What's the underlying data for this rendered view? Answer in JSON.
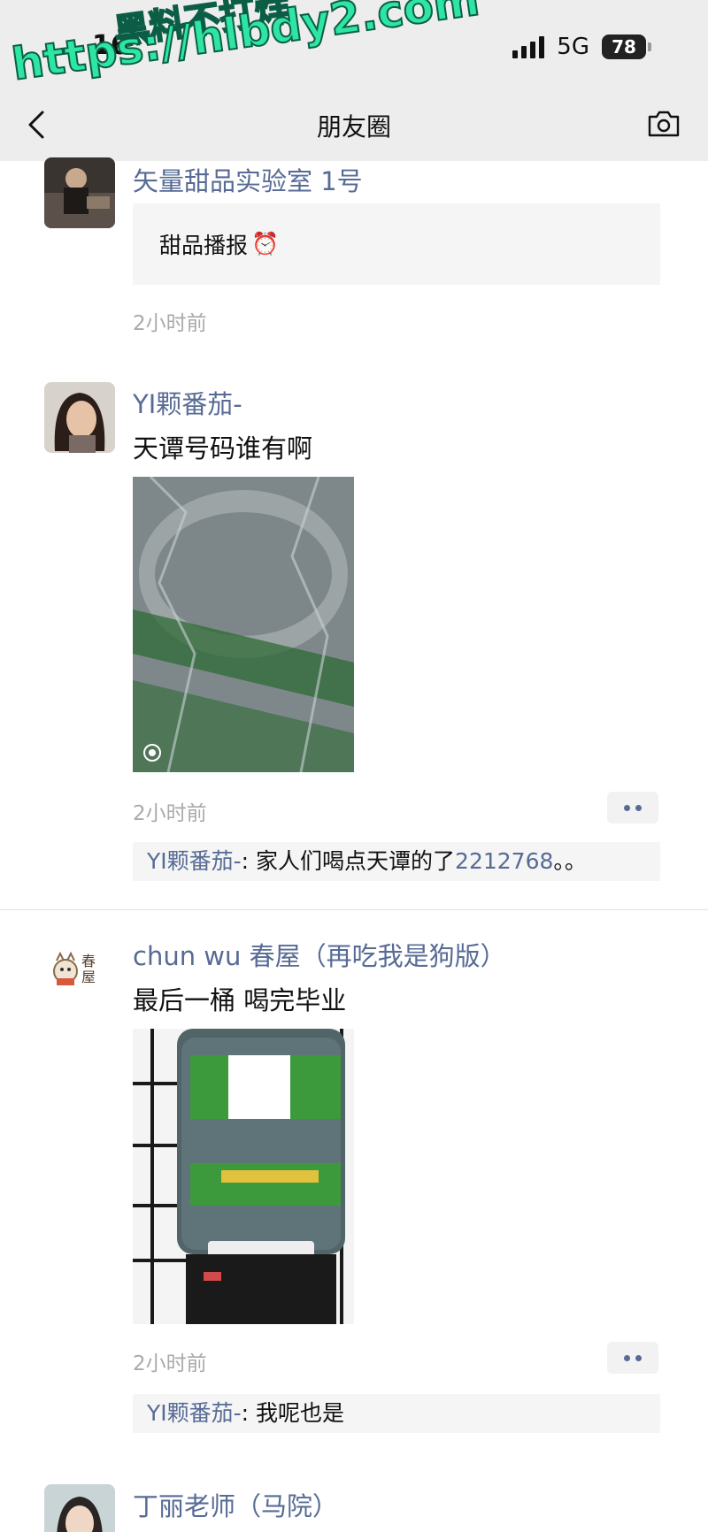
{
  "status_bar": {
    "time": "16",
    "network": "5G",
    "battery": "78"
  },
  "watermark": {
    "line1": "黑料不打烊",
    "line2": "https://hlbdy2.com"
  },
  "nav": {
    "title": "朋友圈"
  },
  "posts": [
    {
      "name": "矢量甜品实验室 1号",
      "quote_text": "甜品播报",
      "quote_emoji": "⏰",
      "time": "2小时前"
    },
    {
      "name": "YI颗番茄-",
      "text": "天谭号码谁有啊",
      "time": "2小时前",
      "comment": {
        "user": "YI颗番茄-",
        "text": ": 家人们喝点天谭的了",
        "number": "2212768",
        "suffix": "。。"
      }
    },
    {
      "name": "chun wu 春屋（再吃我是狗版）",
      "avatar_text": "春屋",
      "text": "最后一桶 喝完毕业",
      "time": "2小时前",
      "comment": {
        "user": "YI颗番茄-",
        "text": ": 我呢也是"
      }
    },
    {
      "name": "丁丽老师（马院）"
    }
  ]
}
